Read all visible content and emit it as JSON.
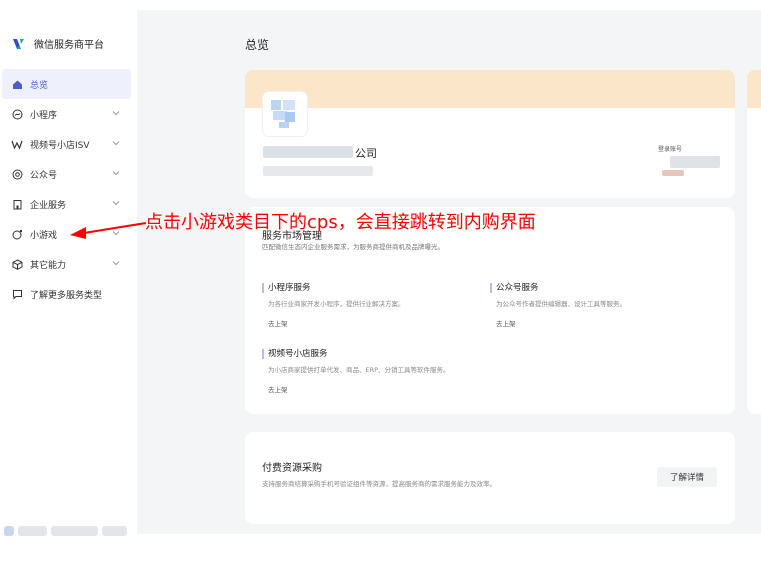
{
  "brand": {
    "name": "微信服务商平台"
  },
  "sidebar": {
    "items": [
      {
        "label": "总览",
        "icon": "home-icon",
        "active": true,
        "chevron": false
      },
      {
        "label": "小程序",
        "icon": "miniprogram-icon",
        "chevron": true
      },
      {
        "label": "视频号小店ISV",
        "icon": "video-channel-icon",
        "chevron": true
      },
      {
        "label": "公众号",
        "icon": "official-account-icon",
        "chevron": true
      },
      {
        "label": "企业服务",
        "icon": "enterprise-icon",
        "chevron": true
      },
      {
        "label": "小游戏",
        "icon": "game-icon",
        "chevron": true
      },
      {
        "label": "其它能力",
        "icon": "cube-icon",
        "chevron": true
      },
      {
        "label": "了解更多服务类型",
        "icon": "chat-icon",
        "chevron": false
      }
    ]
  },
  "main": {
    "title": "总览",
    "company": {
      "name_visible": "公司",
      "account_label": "登录账号"
    },
    "services": {
      "title": "服务市场管理",
      "subtitle": "匹配微信生态内企业服务需求，为服务商提供商机及品牌曝光。",
      "items": [
        {
          "name": "小程序服务",
          "desc": "为各行业商家开发小程序，提供行业解决方案。",
          "link": "去上架"
        },
        {
          "name": "公众号服务",
          "desc": "为公众号作者提供编辑器、设计工具等服务。",
          "link": "去上架"
        },
        {
          "name": "视频号小店服务",
          "desc": "为小店商家提供打单代发、商品、ERP、分销工具等软件服务。",
          "link": "去上架"
        }
      ]
    },
    "purchase": {
      "title": "付费资源采购",
      "desc": "支持服务商结算采购手机号验证组件等资源，提高服务商的需求服务能力及效率。",
      "button": "了解详情"
    }
  },
  "annotation": {
    "text": "点击小游戏类目下的cps，会直接跳转到内购界面",
    "color": "#ff0000"
  },
  "colors": {
    "accent": "#4d5bd1",
    "active_bg": "#eef0fb",
    "band": "#fbe6c9",
    "main_bg": "#f4f5f7"
  }
}
